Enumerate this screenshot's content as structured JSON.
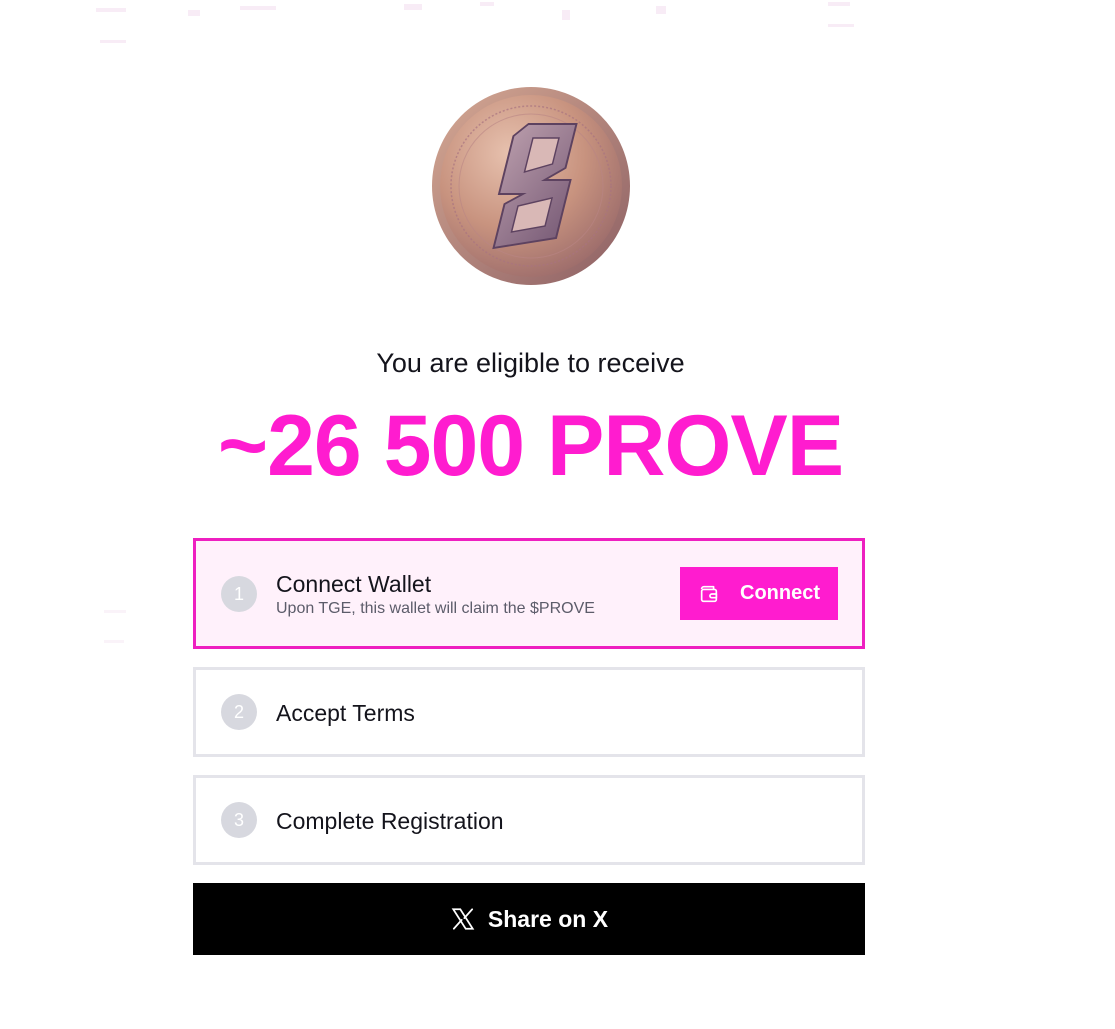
{
  "theme": {
    "accent": "#ff1ccf",
    "accent_border": "#ee1fc0",
    "active_step_bg": "#fff1fb",
    "inactive_border": "#e4e4ea",
    "step_number_bg": "#d7d8df",
    "share_bg": "#000000"
  },
  "hero": {
    "coin_icon": "prove-coin-icon",
    "eligible_text": "You are eligible to receive",
    "amount_text": "~26 500 PROVE"
  },
  "steps": [
    {
      "number": "1",
      "title": "Connect Wallet",
      "subtitle": "Upon TGE, this wallet will claim the $PROVE",
      "active": true,
      "action": {
        "label": "Connect",
        "icon": "wallet-icon"
      }
    },
    {
      "number": "2",
      "title": "Accept Terms",
      "active": false
    },
    {
      "number": "3",
      "title": "Complete Registration",
      "active": false
    }
  ],
  "share": {
    "label": "Share on X",
    "icon": "x-logo-icon"
  }
}
